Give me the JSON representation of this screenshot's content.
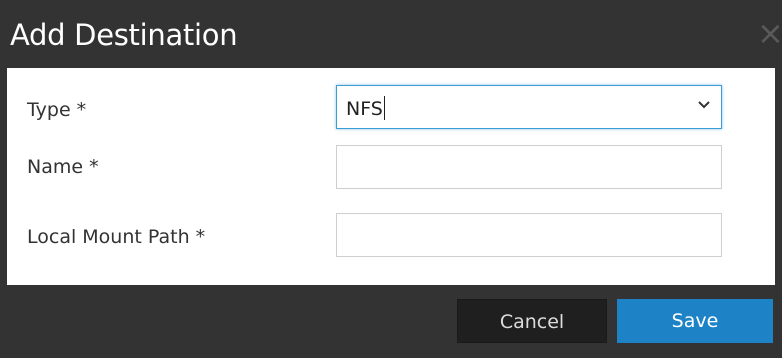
{
  "dialog": {
    "title": "Add Destination",
    "close_icon": "close-icon"
  },
  "form": {
    "type_label": "Type *",
    "type_value": "NFS",
    "name_label": "Name *",
    "name_value": "",
    "mount_label": "Local Mount Path *",
    "mount_value": ""
  },
  "footer": {
    "cancel_label": "Cancel",
    "save_label": "Save"
  },
  "colors": {
    "accent": "#1e83c6",
    "focus_border": "#3d9bd6",
    "dialog_chrome": "#333333"
  }
}
